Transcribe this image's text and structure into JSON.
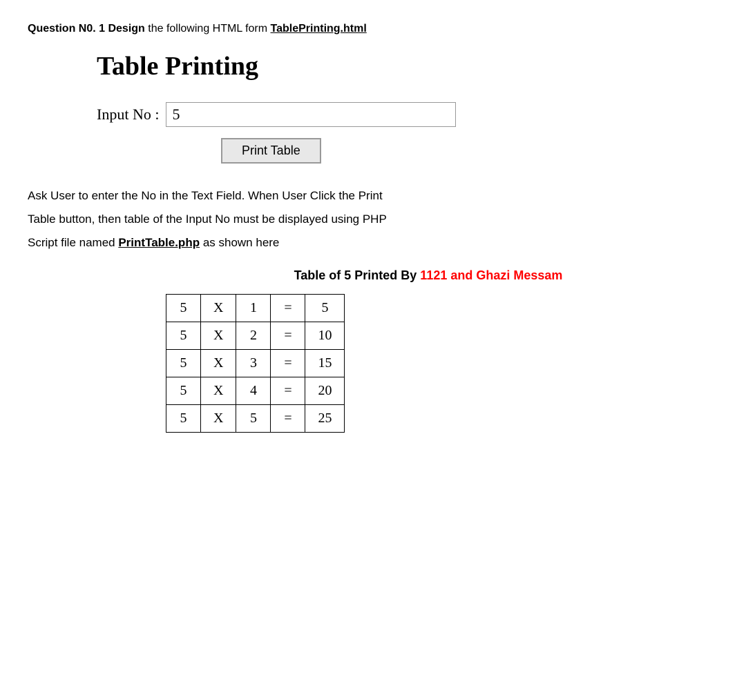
{
  "question": {
    "prefix": "Question N0. 1 Design",
    "suffix": " the following HTML form ",
    "filename": "TablePrinting.html"
  },
  "page_title": "Table Printing",
  "form": {
    "input_label": "Input No :",
    "input_value": "5",
    "button_label": "Print Table"
  },
  "description": {
    "line1": "Ask User to enter the No in the Text Field. When User Click the Print",
    "line2": "Table button, then table of the Input No must be displayed using PHP",
    "line3_prefix": "Script file named ",
    "line3_php": "PrintTable.php",
    "line3_suffix": " as shown here"
  },
  "table_heading": {
    "prefix": "Table of 5 Printed By  ",
    "highlight": "1121 and Ghazi Messam"
  },
  "table_rows": [
    {
      "num": "5",
      "x": "X",
      "multiplier": "1",
      "eq": "=",
      "result": "5"
    },
    {
      "num": "5",
      "x": "X",
      "multiplier": "2",
      "eq": "=",
      "result": "10"
    },
    {
      "num": "5",
      "x": "X",
      "multiplier": "3",
      "eq": "=",
      "result": "15"
    },
    {
      "num": "5",
      "x": "X",
      "multiplier": "4",
      "eq": "=",
      "result": "20"
    },
    {
      "num": "5",
      "x": "X",
      "multiplier": "5",
      "eq": "=",
      "result": "25"
    }
  ]
}
